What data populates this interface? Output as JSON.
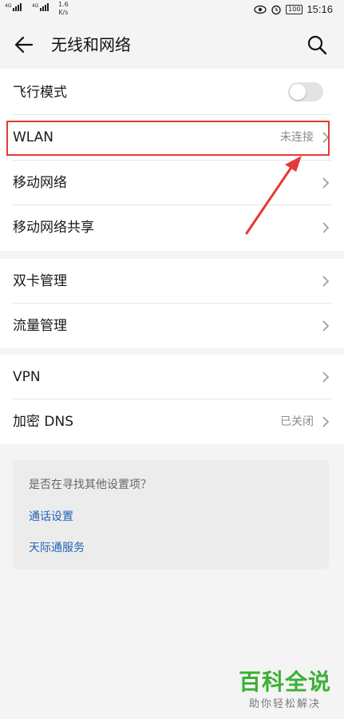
{
  "status_bar": {
    "signal_label": "4G",
    "network_speed_value": "1.6",
    "network_speed_unit": "K/s",
    "battery": "100",
    "time": "15:16"
  },
  "header": {
    "title": "无线和网络"
  },
  "section1": {
    "airplane_mode": {
      "label": "飞行模式",
      "enabled": false
    },
    "wlan": {
      "label": "WLAN",
      "status": "未连接"
    },
    "mobile_network": {
      "label": "移动网络"
    },
    "tethering": {
      "label": "移动网络共享"
    }
  },
  "section2": {
    "dual_sim": {
      "label": "双卡管理"
    },
    "data_usage": {
      "label": "流量管理"
    }
  },
  "section3": {
    "vpn": {
      "label": "VPN"
    },
    "private_dns": {
      "label": "加密 DNS",
      "status": "已关闭"
    }
  },
  "suggestions": {
    "question": "是否在寻找其他设置项？",
    "links": [
      "通话设置",
      "天际通服务"
    ]
  },
  "watermark": {
    "main": "百科全说",
    "sub": "助你轻松解决"
  },
  "colors": {
    "highlight": "#e53935",
    "link": "#1e64b4",
    "watermark_green": "#3cb034"
  }
}
